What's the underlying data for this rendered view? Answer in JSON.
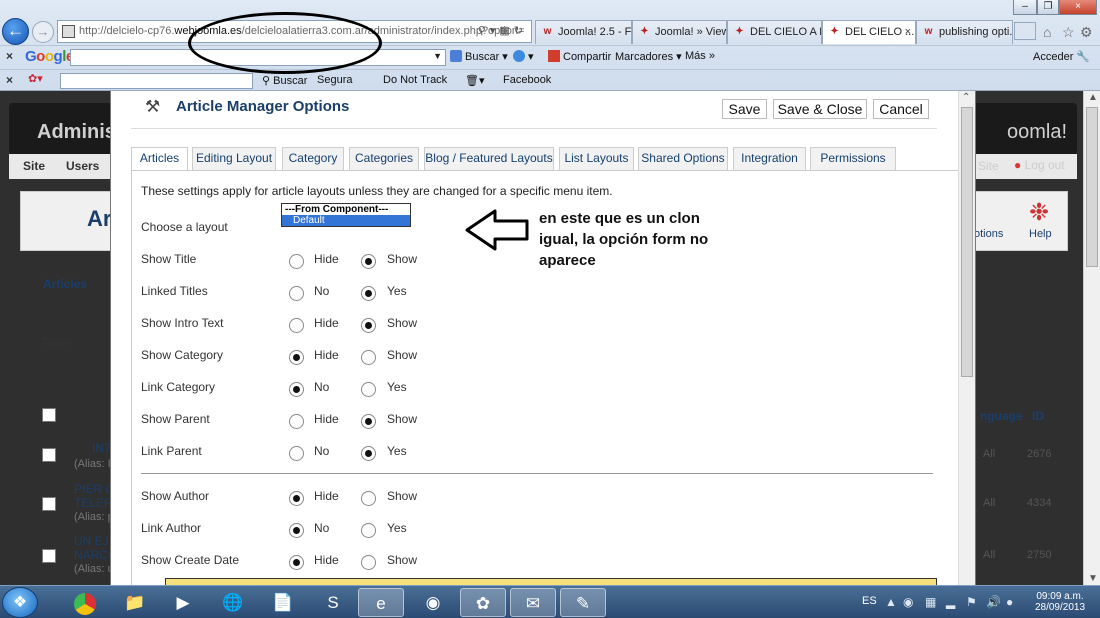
{
  "browser": {
    "url_prefix": "http://delcielo-cp76.",
    "url_domain": "webjoomla.es",
    "url_path": "/delcieloalatierra3.com.ar/administrator/index.php?option=",
    "tabs": [
      {
        "label": "Joomla! 2.5 - F..."
      },
      {
        "label": "Joomla! » View ..."
      },
      {
        "label": "DEL CIELO A L..."
      },
      {
        "label": "DEL CIELO ..."
      },
      {
        "label": "publishing opti..."
      }
    ],
    "google_bar": {
      "logo": "Google",
      "search_label": "Buscar",
      "share_label": "Compartir",
      "bookmarks_label": "Marcadores",
      "more_label": "Más",
      "signin_label": "Acceder"
    },
    "toolbar3": {
      "search_label": "Buscar",
      "safe_label": "Segura",
      "dnt_label": "Do Not Track",
      "facebook_label": "Facebook"
    }
  },
  "background_page": {
    "admin_title": "Adminis",
    "joomla_logo": "oomla!",
    "submenu": [
      "Site",
      "Users"
    ],
    "right_links": [
      "Site",
      "Log out"
    ],
    "toolbar_right": [
      "otions",
      "Help"
    ],
    "articles_tab": "Articles",
    "filter_label": "Filter:",
    "list_columns": [
      "nguage",
      "ID"
    ],
    "rows": [
      {
        "title": "INT",
        "alias": "(Alias: I",
        "lang": "All",
        "id": "2676"
      },
      {
        "title": "PIER C TELER",
        "alias": "(Alias: p",
        "lang": "All",
        "id": "4334"
      },
      {
        "title": "UN EJ NARCC",
        "alias": "(Alias: u",
        "lang": "All",
        "id": "2750"
      }
    ],
    "title_fragment": "Ar"
  },
  "modal": {
    "title": "Article Manager Options",
    "buttons": {
      "save": "Save",
      "save_close": "Save & Close",
      "cancel": "Cancel"
    },
    "tabs": [
      "Articles",
      "Editing Layout",
      "Category",
      "Categories",
      "Blog / Featured Layouts",
      "List Layouts",
      "Shared Options",
      "Integration",
      "Permissions"
    ],
    "intro": "These settings apply for article layouts unless they are changed for a specific menu item.",
    "layout_label": "Choose a layout",
    "layout_options": [
      "---From Component---",
      "Default"
    ],
    "options": [
      {
        "label": "Show Title",
        "opt1": "Hide",
        "opt2": "Show",
        "selected": 2
      },
      {
        "label": "Linked Titles",
        "opt1": "No",
        "opt2": "Yes",
        "selected": 2
      },
      {
        "label": "Show Intro Text",
        "opt1": "Hide",
        "opt2": "Show",
        "selected": 2
      },
      {
        "label": "Show Category",
        "opt1": "Hide",
        "opt2": "Show",
        "selected": 1
      },
      {
        "label": "Link Category",
        "opt1": "No",
        "opt2": "Yes",
        "selected": 1
      },
      {
        "label": "Show Parent",
        "opt1": "Hide",
        "opt2": "Show",
        "selected": 2
      },
      {
        "label": "Link Parent",
        "opt1": "No",
        "opt2": "Yes",
        "selected": 2
      },
      {
        "label": "Show Author",
        "opt1": "Hide",
        "opt2": "Show",
        "selected": 1
      },
      {
        "label": "Link Author",
        "opt1": "No",
        "opt2": "Yes",
        "selected": 1
      },
      {
        "label": "Show Create Date",
        "opt1": "Hide",
        "opt2": "Show",
        "selected": 1
      }
    ]
  },
  "annotation": {
    "text": "en este que es un clon igual, la opción form no aparece"
  },
  "taskbar": {
    "lang": "ES",
    "time": "09:09 a.m.",
    "date": "28/09/2013"
  },
  "colors": {
    "accent": "#1b3f6b",
    "selection": "#3375d6",
    "highlight_bar": "#f6e07b"
  }
}
